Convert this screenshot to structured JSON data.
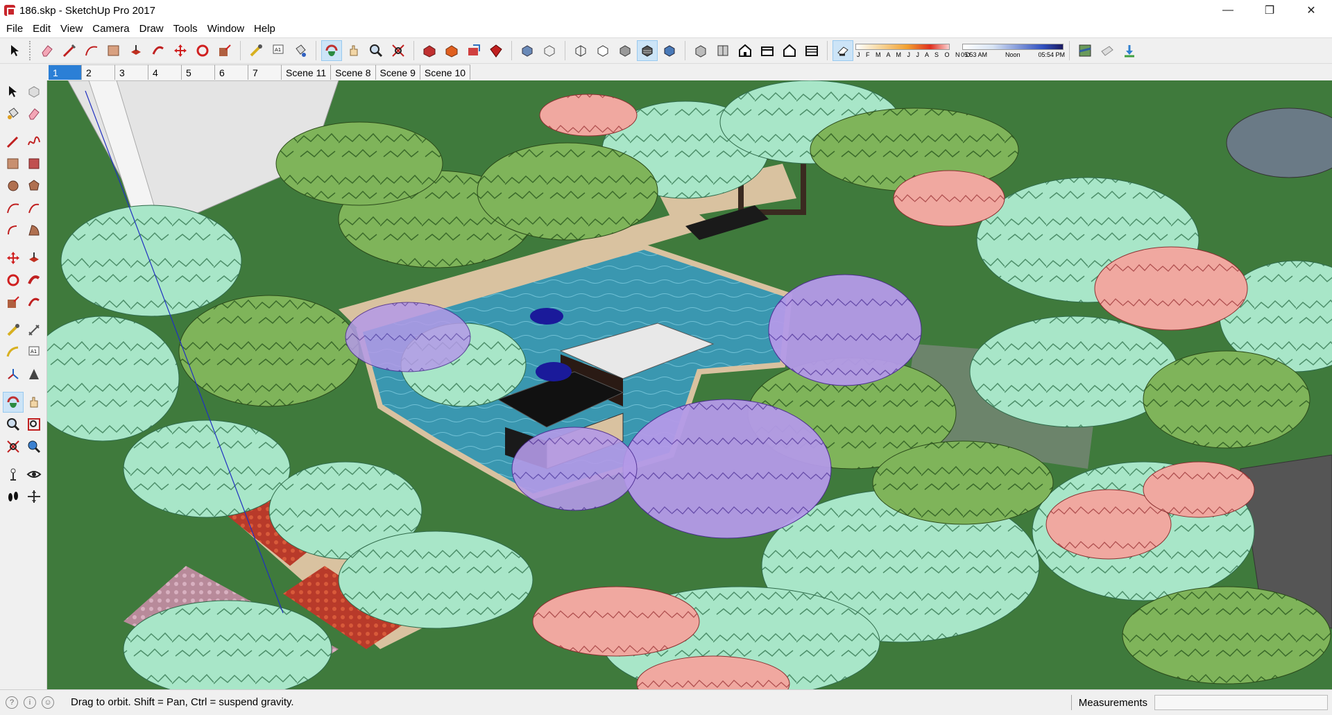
{
  "window": {
    "title": "186.skp - SketchUp Pro 2017",
    "controls": [
      "—",
      "❐",
      "✕"
    ]
  },
  "menu": [
    "File",
    "Edit",
    "View",
    "Camera",
    "Draw",
    "Tools",
    "Window",
    "Help"
  ],
  "toolbar": {
    "shadow_months": "J F M A M J J A S O N D",
    "time_start": "05:53 AM",
    "time_mid": "Noon",
    "time_end": "05:54 PM"
  },
  "scenes": [
    "1",
    "2",
    "3",
    "4",
    "5",
    "6",
    "7",
    "Scene 11",
    "Scene 8",
    "Scene 9",
    "Scene 10"
  ],
  "active_scene": "1",
  "status": {
    "message": "Drag to orbit. Shift = Pan, Ctrl = suspend gravity.",
    "measurements_label": "Measurements",
    "measurements_value": ""
  },
  "colors": {
    "grass": "#3f7a3c",
    "water": "#3a97b0",
    "path": "#d9c2a0",
    "tree_mint": "#a8e6c8",
    "tree_green": "#6aa84f",
    "tree_lavender": "#b49ae8",
    "tree_pink": "#f0a8a0",
    "accent": "#2b7fd6"
  }
}
